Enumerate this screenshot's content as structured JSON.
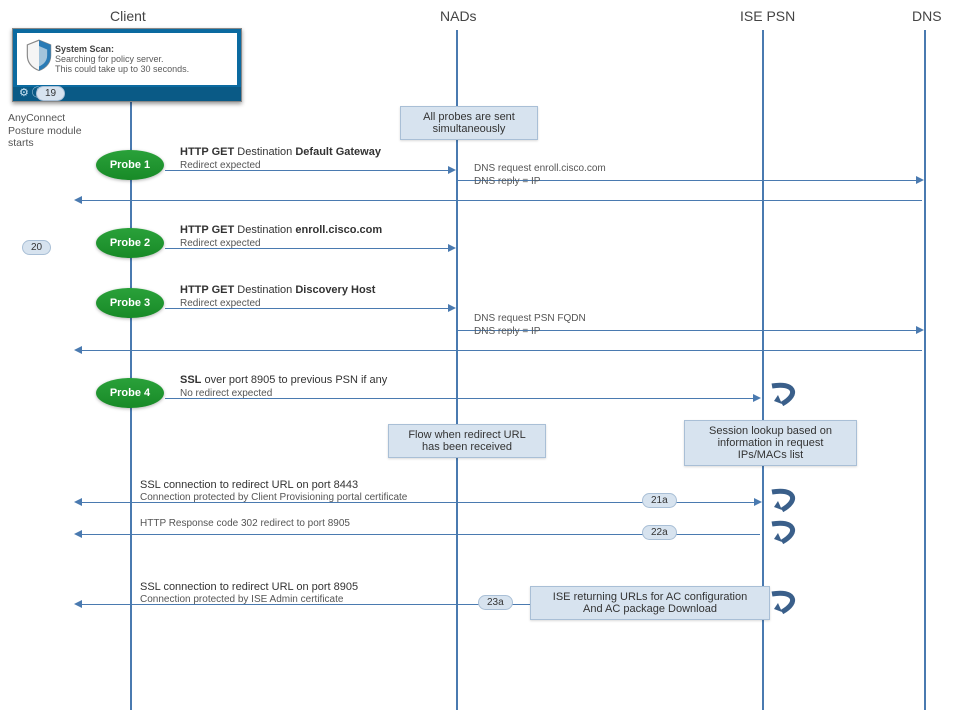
{
  "lanes": {
    "client": "Client",
    "nads": "NADs",
    "isepsn": "ISE PSN",
    "dns": "DNS"
  },
  "systemscan": {
    "title": "System Scan:",
    "line1": "Searching for policy server.",
    "line2": "This could take up to 30 seconds."
  },
  "badges": {
    "b19": "19",
    "b20": "20",
    "b21a": "21a",
    "b22a": "22a",
    "b23a": "23a"
  },
  "anyconnect": {
    "line1": "AnyConnect",
    "line2": "Posture module",
    "line3": "starts"
  },
  "probes": {
    "p1": "Probe 1",
    "p2": "Probe 2",
    "p3": "Probe 3",
    "p4": "Probe 4"
  },
  "notes": {
    "n1a": "All probes are sent",
    "n1b": "simultaneously",
    "n2a": "Flow when redirect URL",
    "n2b": "has been received",
    "n3a": "Session lookup based on",
    "n3b": "information in request",
    "n3c": "IPs/MACs list",
    "n4a": "ISE returning URLs for AC configuration",
    "n4b": "And AC package Download"
  },
  "messages": {
    "m1a": "HTTP GET",
    "m1b": " Destination ",
    "m1c": "Default Gateway",
    "m1sub": "Redirect expected",
    "m2a": "DNS request enroll.cisco.com",
    "m2b": "DNS reply = IP",
    "m3a": "HTTP GET",
    "m3b": " Destination ",
    "m3c": "enroll.cisco.com",
    "m3sub": "Redirect expected",
    "m4a": "HTTP GET",
    "m4b": " Destination ",
    "m4c": "Discovery Host",
    "m4sub": "Redirect expected",
    "m5a": "DNS request PSN FQDN",
    "m5b": "DNS reply = IP",
    "m6a": "SSL",
    "m6b": " over port 8905 to previous PSN if any",
    "m6sub": "No redirect expected",
    "m7a": "SSL connection to redirect URL on port 8443",
    "m7b": "Connection  protected by Client Provisioning  portal certificate",
    "m8": "HTTP Response code 302 redirect to port 8905",
    "m9a": "SSL connection to redirect URL on port 8905",
    "m9b": "Connection  protected by ISE Admin certificate"
  },
  "chart_data": {
    "type": "sequence-diagram",
    "participants": [
      "Client",
      "NADs",
      "ISE PSN",
      "DNS"
    ],
    "initial_note": "AnyConnect Posture module starts (System Scan: Searching for policy server. This could take up to 30 seconds.)",
    "global_note": "All probes are sent simultaneously",
    "steps": [
      {
        "id": "19",
        "at": "Client",
        "text": "System Scan badge"
      },
      {
        "id": "20",
        "at": "Client",
        "text": "Probes stage badge"
      },
      {
        "probe": "Probe 1",
        "from": "Client",
        "to": "NADs",
        "text": "HTTP GET Destination Default Gateway",
        "sub": "Redirect expected"
      },
      {
        "from": "NADs",
        "to": "DNS",
        "text": "DNS request enroll.cisco.com"
      },
      {
        "from": "DNS",
        "to": "Client",
        "text": "DNS reply = IP"
      },
      {
        "probe": "Probe 2",
        "from": "Client",
        "to": "NADs",
        "text": "HTTP GET Destination enroll.cisco.com",
        "sub": "Redirect expected"
      },
      {
        "probe": "Probe 3",
        "from": "Client",
        "to": "NADs",
        "text": "HTTP GET Destination Discovery Host",
        "sub": "Redirect expected"
      },
      {
        "from": "NADs",
        "to": "DNS",
        "text": "DNS request PSN FQDN"
      },
      {
        "from": "DNS",
        "to": "Client",
        "text": "DNS reply = IP"
      },
      {
        "probe": "Probe 4",
        "from": "Client",
        "to": "ISE PSN",
        "text": "SSL over port 8905 to previous PSN if any",
        "sub": "No redirect expected"
      },
      {
        "note_at": "ISE PSN",
        "text": "Session lookup based on information in request IPs/MACs list"
      },
      {
        "note_at": "NADs",
        "text": "Flow when redirect URL has been received"
      },
      {
        "id": "21a",
        "from": "Client",
        "to": "ISE PSN",
        "text": "SSL connection to redirect URL on port 8443",
        "sub": "Connection protected by Client Provisioning portal certificate"
      },
      {
        "id": "22a",
        "from": "ISE PSN",
        "to": "Client",
        "text": "HTTP Response code 302 redirect to port 8905"
      },
      {
        "id": "23a",
        "from": "Client",
        "to": "ISE PSN",
        "text": "SSL connection to redirect URL on port 8905",
        "sub": "Connection protected by ISE Admin certificate"
      },
      {
        "note_at": "ISE PSN",
        "text": "ISE returning URLs for AC configuration And AC package Download"
      }
    ]
  }
}
